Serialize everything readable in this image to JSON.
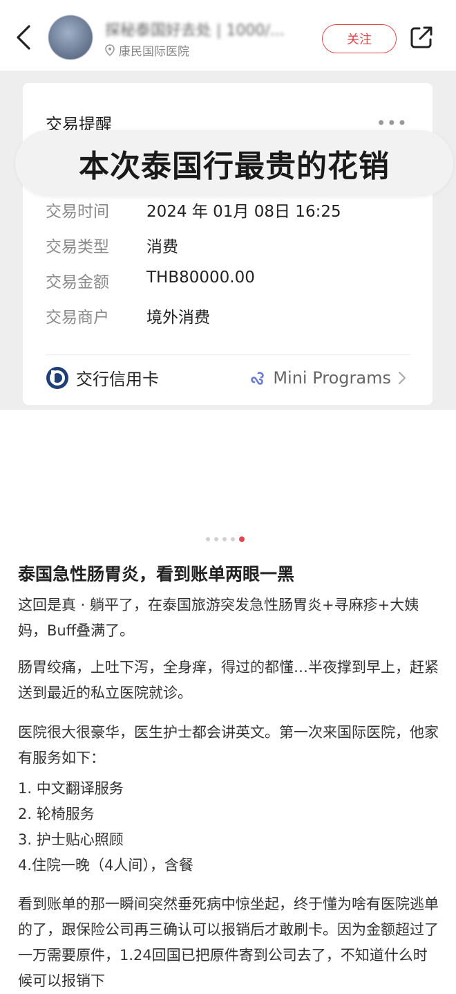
{
  "header": {
    "author": "探秘泰国好去处 | 1000/...",
    "location": "康民国际医院",
    "follow_label": "关注"
  },
  "card": {
    "title": "交易提醒",
    "more": "•••",
    "banner": "本次泰国行最贵的花销",
    "rows": [
      {
        "key": "交易时间",
        "value": "2024 年 01月 08日 16:25"
      },
      {
        "key": "交易类型",
        "value": "消费"
      },
      {
        "key": "交易金额",
        "value": "THB80000.00"
      },
      {
        "key": "交易商户",
        "value": "境外消费"
      }
    ],
    "bank_name": "交行信用卡",
    "mini_programs": "Mini Programs"
  },
  "carousel": {
    "total": 5,
    "active_index": 4
  },
  "post": {
    "title": "泰国急性肠胃炎，看到账单两眼一黑",
    "paragraphs": [
      "这回是真 · 躺平了，在泰国旅游突发急性肠胃炎+寻麻疹+大姨妈，Buff叠满了。",
      "肠胃绞痛，上吐下泻，全身痒，得过的都懂…半夜撑到早上，赶紧送到最近的私立医院就诊。",
      "医院很大很豪华，医生护士都会讲英文。第一次来国际医院，他家有服务如下：",
      "1. 中文翻译服务\n2. 轮椅服务\n3. 护士贴心照顾\n4.住院一晚（4人间），含餐",
      "看到账单的那一瞬间突然垂死病中惊坐起，终于懂为啥有医院逃单的了，跟保险公司再三确认可以报销后才敢刷卡。因为金额超过了一万需要原件，1.24回国已把原件寄到公司去了，不知道什么时候可以报销下"
    ]
  },
  "colors": {
    "accent": "#e0484e",
    "background": "#ffffff",
    "image_bg": "#eeeeee"
  }
}
